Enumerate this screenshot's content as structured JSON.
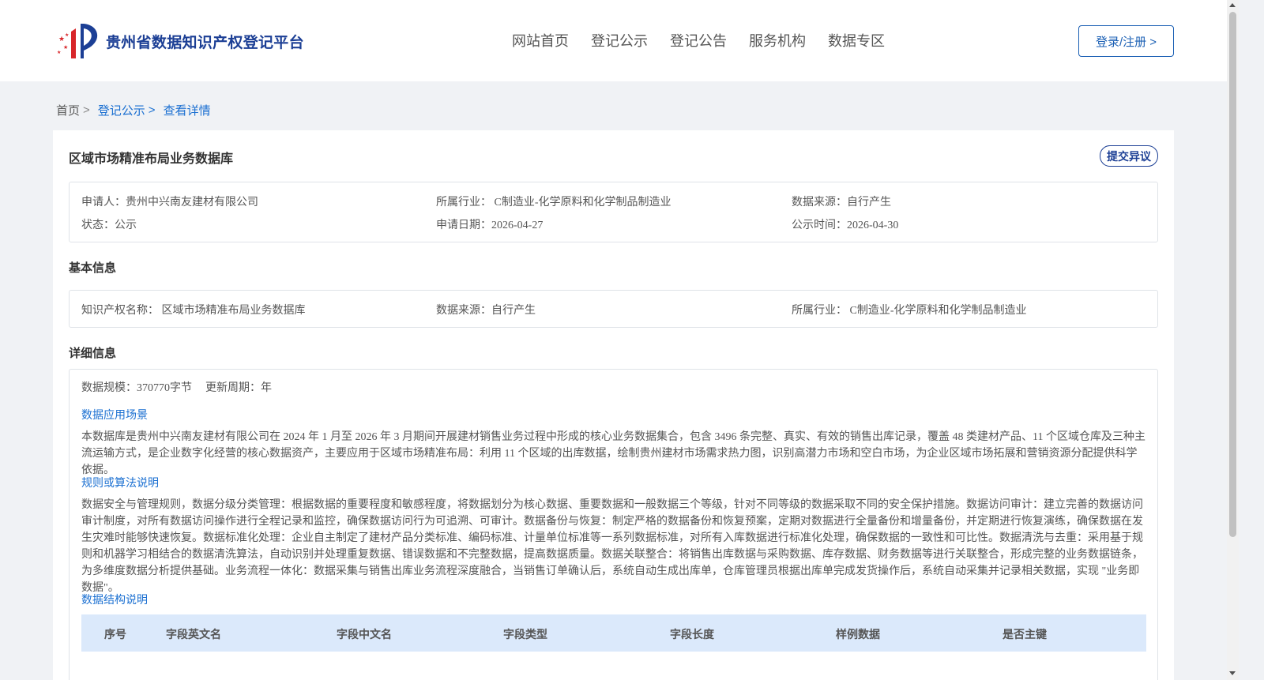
{
  "header": {
    "logo_text": "贵州省数据知识产权登记平台",
    "nav": [
      "网站首页",
      "登记公示",
      "登记公告",
      "服务机构",
      "数据专区"
    ],
    "login_label": "登录/注册 >"
  },
  "breadcrumb": {
    "home": "首页",
    "sep": ">",
    "level1": "登记公示",
    "current": "查看详情"
  },
  "card": {
    "title": "区域市场精准布局业务数据库",
    "objection_label": "提交异议",
    "summary": {
      "applicant": "申请人：贵州中兴南友建材有限公司",
      "industry": "所属行业： C制造业-化学原料和化学制品制造业",
      "source": "数据来源：自行产生",
      "status": "状态：公示",
      "apply_date": "申请日期：2026-04-27",
      "publish_date": "公示时间：2026-04-30"
    },
    "basic_label": "基本信息",
    "basic": {
      "ip_name": "知识产权名称： 区域市场精准布局业务数据库",
      "source": "数据来源：自行产生",
      "industry": "所属行业： C制造业-化学原料和化学制品制造业"
    },
    "detail_label": "详细信息",
    "detail": {
      "scale": "数据规模：370770字节",
      "cycle": "更新周期：年",
      "scenario_title": "数据应用场景",
      "scenario_text": "本数据库是贵州中兴南友建材有限公司在 2024 年 1 月至 2026 年 3 月期间开展建材销售业务过程中形成的核心业务数据集合，包含 3496 条完整、真实、有效的销售出库记录，覆盖 48 类建材产品、11 个区域仓库及三种主流运输方式，是企业数字化经营的核心数据资产，主要应用于区域市场精准布局：利用 11 个区域的出库数据，绘制贵州建材市场需求热力图，识别高潜力市场和空白市场，为企业区域市场拓展和营销资源分配提供科学依据。",
      "rules_title": "规则或算法说明",
      "rules_text": "数据安全与管理规则，数据分级分类管理：根据数据的重要程度和敏感程度，将数据划分为核心数据、重要数据和一般数据三个等级，针对不同等级的数据采取不同的安全保护措施。数据访问审计：建立完善的数据访问审计制度，对所有数据访问操作进行全程记录和监控，确保数据访问行为可追溯、可审计。数据备份与恢复：制定严格的数据备份和恢复预案，定期对数据进行全量备份和增量备份，并定期进行恢复演练，确保数据在发生灾难时能够快速恢复。数据标准化处理：企业自主制定了建材产品分类标准、编码标准、计量单位标准等一系列数据标准，对所有入库数据进行标准化处理，确保数据的一致性和可比性。数据清洗与去重：采用基于规则和机器学习相结合的数据清洗算法，自动识别并处理重复数据、错误数据和不完整数据，提高数据质量。数据关联整合：将销售出库数据与采购数据、库存数据、财务数据等进行关联整合，形成完整的业务数据链条，为多维度数据分析提供基础。业务流程一体化：数据采集与销售出库业务流程深度融合，当销售订单确认后，系统自动生成出库单，仓库管理员根据出库单完成发货操作后，系统自动采集并记录相关数据，实现 \"业务即数据\"。",
      "structure_title": "数据结构说明",
      "table_headers": [
        "序号",
        "字段英文名",
        "字段中文名",
        "字段类型",
        "字段长度",
        "样例数据",
        "是否主键"
      ]
    }
  },
  "colors": {
    "brand": "#1c3f95",
    "link": "#1a6fd1",
    "table_header_bg": "#dbe9fb"
  }
}
